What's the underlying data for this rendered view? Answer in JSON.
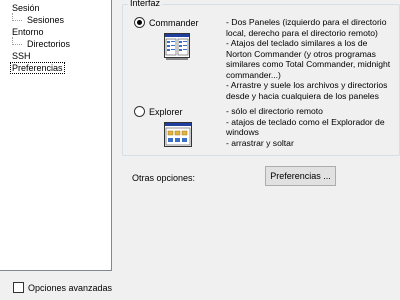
{
  "tree": {
    "items": [
      {
        "label": "Sesión"
      },
      {
        "label": "Sesiones"
      },
      {
        "label": "Entorno"
      },
      {
        "label": "Directorios"
      },
      {
        "label": "SSH"
      },
      {
        "label": "Preferencias"
      }
    ],
    "selected": "Preferencias"
  },
  "advanced_options": {
    "label": "Opciones avanzadas",
    "checked": false
  },
  "interface_group": {
    "title": "Interfaz",
    "commander": {
      "label": "Commander",
      "selected": true,
      "icon": "commander-window-icon",
      "description": [
        "- Dos Paneles (izquierdo para el directorio",
        "local, derecho para el directorio remoto)",
        "- Atajos del teclado similares a los de",
        "Norton Commander (y otros programas",
        "similares como Total Commander, midnight",
        "commander...)",
        "- Arrastre y suele los archivos y directorios",
        "desde y hacia cualquiera de los paneles"
      ]
    },
    "explorer": {
      "label": "Explorer",
      "selected": false,
      "icon": "explorer-window-icon",
      "description": [
        "- sólo el directorio remoto",
        "- atajos de teclado como el Explorador de",
        "windows",
        "- arrastrar y soltar"
      ]
    }
  },
  "other_options": {
    "label": "Otras opciones:",
    "button_label": "Preferencias ..."
  }
}
